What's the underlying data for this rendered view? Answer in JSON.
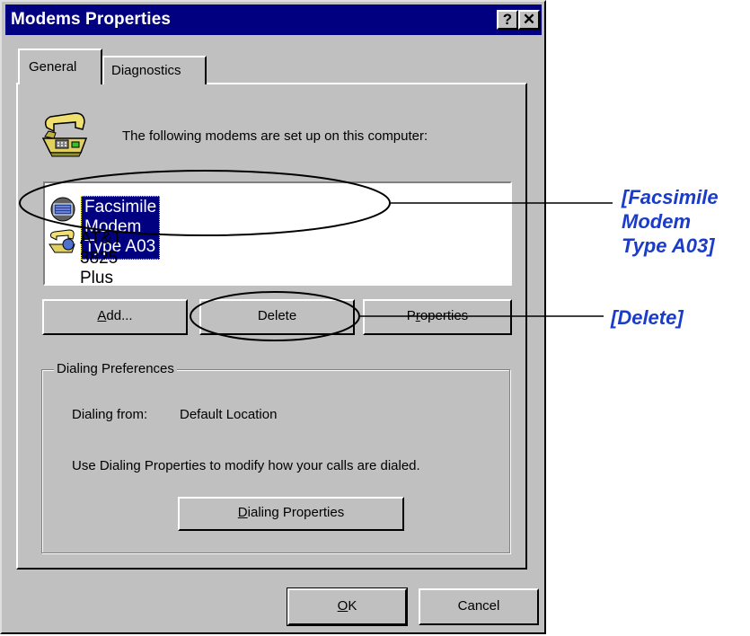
{
  "window": {
    "title": "Modems Properties",
    "help_button": "?",
    "close_button": "✕"
  },
  "tabs": [
    {
      "label": "General",
      "active": true
    },
    {
      "label": "Diagnostics",
      "active": false
    }
  ],
  "intro_text": "The following modems are set up on this computer:",
  "modems": [
    {
      "name": "Facsimile Modem Type A03",
      "selected": true,
      "icon": "modem-icon"
    },
    {
      "name": "AT&T 3825 Plus",
      "selected": false,
      "icon": "modem-icon"
    }
  ],
  "buttons": {
    "add_first": "A",
    "add_rest": "dd...",
    "delete": "Delete",
    "properties_pre": "P",
    "properties_ul": "r",
    "properties_rest": "operties"
  },
  "dialing": {
    "legend": "Dialing Preferences",
    "from_label": "Dialing from:",
    "from_value": "Default Location",
    "description": "Use Dialing Properties to modify how your calls are dialed.",
    "button_first": "D",
    "button_rest": "ialing Properties"
  },
  "footer": {
    "ok_first": "O",
    "ok_rest": "K",
    "cancel": "Cancel"
  },
  "annotations": {
    "modem_callout_line1": "[Facsimile",
    "modem_callout_line2": "Modem",
    "modem_callout_line3": "Type A03]",
    "delete_callout": "[Delete]"
  },
  "colors": {
    "titlebar": "#000080",
    "face": "#c0c0c0",
    "selection": "#000080",
    "callout": "#1a3cc8"
  }
}
